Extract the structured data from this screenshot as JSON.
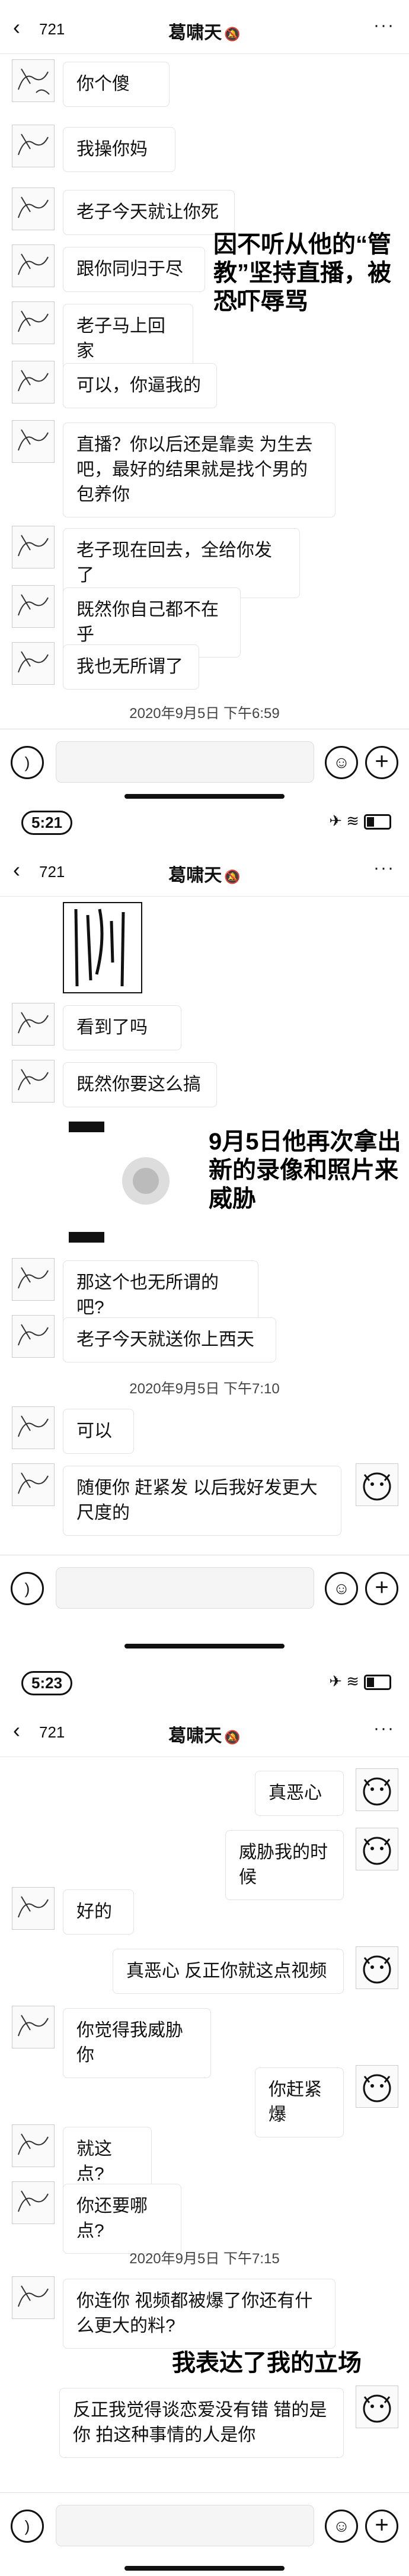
{
  "colors": {
    "text": "#111111",
    "bubble_border": "#e3e3e3",
    "header_border": "#e6e6e6"
  },
  "header": {
    "back_icon": "chevron-left-icon",
    "unread_count": "721",
    "title": "葛啸天",
    "mute_icon": "bell-muted-icon",
    "more_icon": "ellipsis-icon",
    "more": "···"
  },
  "status_bar": {
    "time_2": "5:21",
    "time_3": "5:23",
    "icons": "airplane, wifi, battery",
    "airplane": "✈",
    "wifi": "≋"
  },
  "input_bar": {
    "voice_icon": "voice-icon",
    "emoji_icon": "emoji-icon",
    "plus_icon": "plus-icon",
    "voice": ")",
    "emoji": "☺",
    "plus": "+"
  },
  "screen1": {
    "messages": [
      {
        "side": "left",
        "text": "你个傻"
      },
      {
        "side": "left",
        "text": "我操你妈"
      },
      {
        "side": "left",
        "text": "老子今天就让你死"
      },
      {
        "side": "left",
        "text": "跟你同归于尽"
      },
      {
        "side": "left",
        "text": "老子马上回家"
      },
      {
        "side": "left",
        "text": "可以，你逼我的"
      },
      {
        "side": "left",
        "text": "直播？你以后还是靠卖 为生去吧，最好的结果就是找个男的包养你"
      },
      {
        "side": "left",
        "text": "老子现在回去，全给你发了"
      },
      {
        "side": "left",
        "text": "既然你自己都不在乎"
      },
      {
        "side": "left",
        "text": "我也无所谓了"
      }
    ],
    "timestamp": "2020年9月5日 下午6:59",
    "annotation": "因不听从他的“管教”坚持直播，被恐吓辱骂"
  },
  "screen2": {
    "messages": [
      {
        "side": "left",
        "text": "看到了吗"
      },
      {
        "side": "left",
        "text": "既然你要这么搞"
      },
      {
        "side": "left",
        "text": "那这个也无所谓的吧?"
      },
      {
        "side": "left",
        "text": "老子今天就送你上西天"
      }
    ],
    "timestamp": "2020年9月5日 下午7:10",
    "messages_after": [
      {
        "side": "left",
        "text": "可以"
      },
      {
        "side": "left",
        "text": "随便你 赶紧发 以后我好发更大尺度的"
      }
    ],
    "annotation": "9月5日他再次拿出新的录像和照片来威胁"
  },
  "screen3": {
    "messages": [
      {
        "side": "right",
        "text": "真恶心"
      },
      {
        "side": "right",
        "text": "威胁我的时候"
      },
      {
        "side": "left",
        "text": "好的"
      },
      {
        "side": "right",
        "text": "真恶心 反正你就这点视频"
      },
      {
        "side": "left",
        "text": "你觉得我威胁你"
      },
      {
        "side": "right",
        "text": "你赶紧爆"
      },
      {
        "side": "left",
        "text": "就这点?"
      },
      {
        "side": "left",
        "text": "你还要哪点?"
      }
    ],
    "timestamp": "2020年9月5日 下午7:15",
    "messages_after": [
      {
        "side": "left",
        "text": "你连你 视频都被爆了你还有什么更大的料?"
      },
      {
        "side": "right",
        "text": "反正我觉得谈恋爱没有错 错的是你 拍这种事情的人是你"
      }
    ],
    "annotation": "我表达了我的立场"
  }
}
